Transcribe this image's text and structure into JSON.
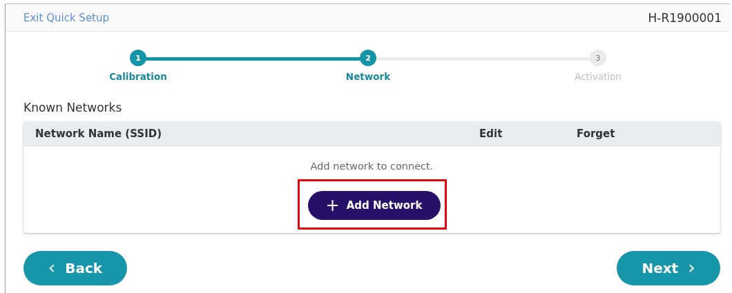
{
  "header": {
    "exit_link": "Exit Quick Setup",
    "device_id": "H-R1900001"
  },
  "steps": [
    {
      "number": "1",
      "label": "Calibration",
      "active": true
    },
    {
      "number": "2",
      "label": "Network",
      "active": true
    },
    {
      "number": "3",
      "label": "Activation",
      "active": false
    }
  ],
  "section_title": "Known Networks",
  "table": {
    "columns": [
      "Network Name (SSID)",
      "Edit",
      "Forget"
    ],
    "empty_message": "Add network to connect."
  },
  "add_button": {
    "icon": "+",
    "label": "Add Network",
    "highlighted": true
  },
  "back_button": {
    "icon": "‹",
    "label": "Back"
  },
  "next_button": {
    "label": "Next",
    "icon": "›"
  }
}
